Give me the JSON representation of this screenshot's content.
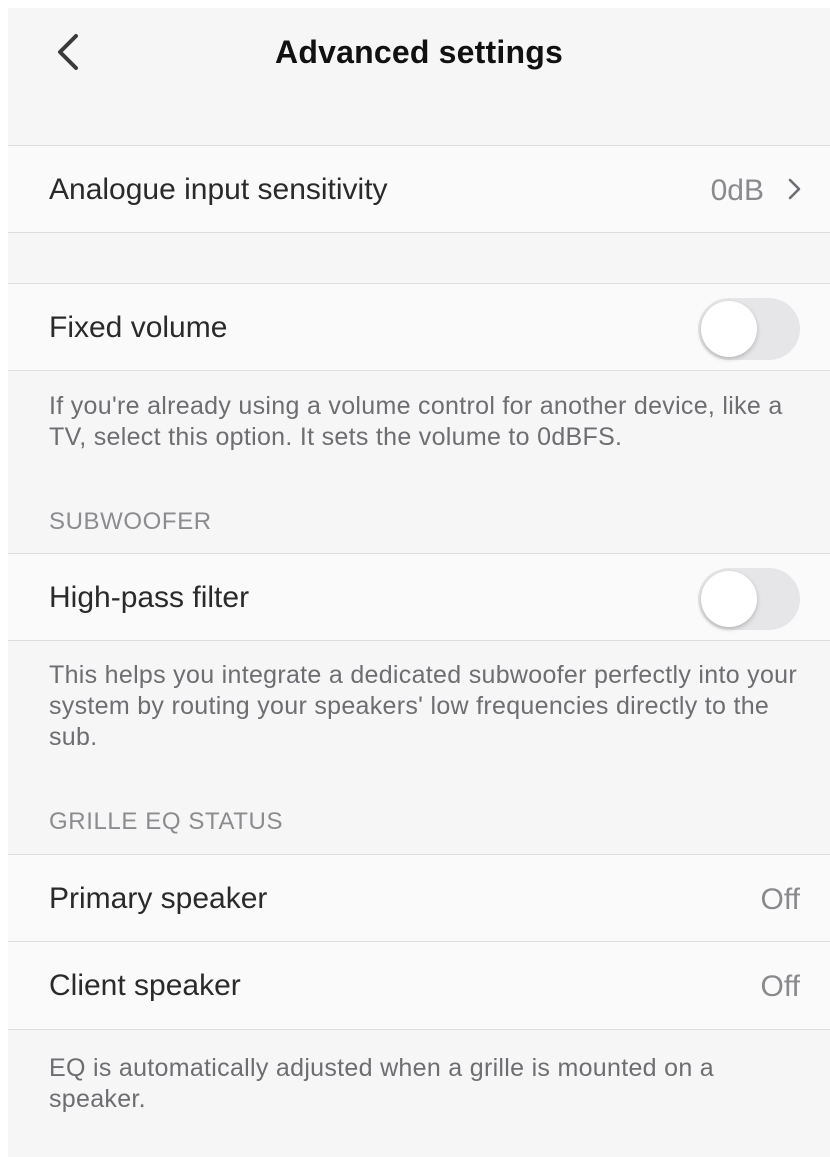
{
  "header": {
    "title": "Advanced settings",
    "back_icon": "chevron-left-icon"
  },
  "analogue": {
    "label": "Analogue input sensitivity",
    "value": "0dB",
    "chevron_icon": "chevron-right-icon"
  },
  "fixed_volume": {
    "label": "Fixed volume",
    "enabled": false,
    "note": "If you're already using a volume control for another device, like a TV, select this option. It sets the volume to 0dBFS."
  },
  "subwoofer": {
    "section_title": "SUBWOOFER",
    "high_pass": {
      "label": "High-pass filter",
      "enabled": false
    },
    "note": "This helps you integrate a dedicated subwoofer perfectly into your system by routing your speakers' low frequencies directly to the sub."
  },
  "grille": {
    "section_title": "GRILLE EQ STATUS",
    "primary": {
      "label": "Primary speaker",
      "value": "Off"
    },
    "client": {
      "label": "Client speaker",
      "value": "Off"
    },
    "note": "EQ is automatically adjusted when a grille is mounted on a speaker."
  },
  "colors": {
    "background": "#f6f6f6",
    "row_background": "#fafafa",
    "toggle_off": "#e6e6e8",
    "secondary_text": "#8a8a8e"
  }
}
